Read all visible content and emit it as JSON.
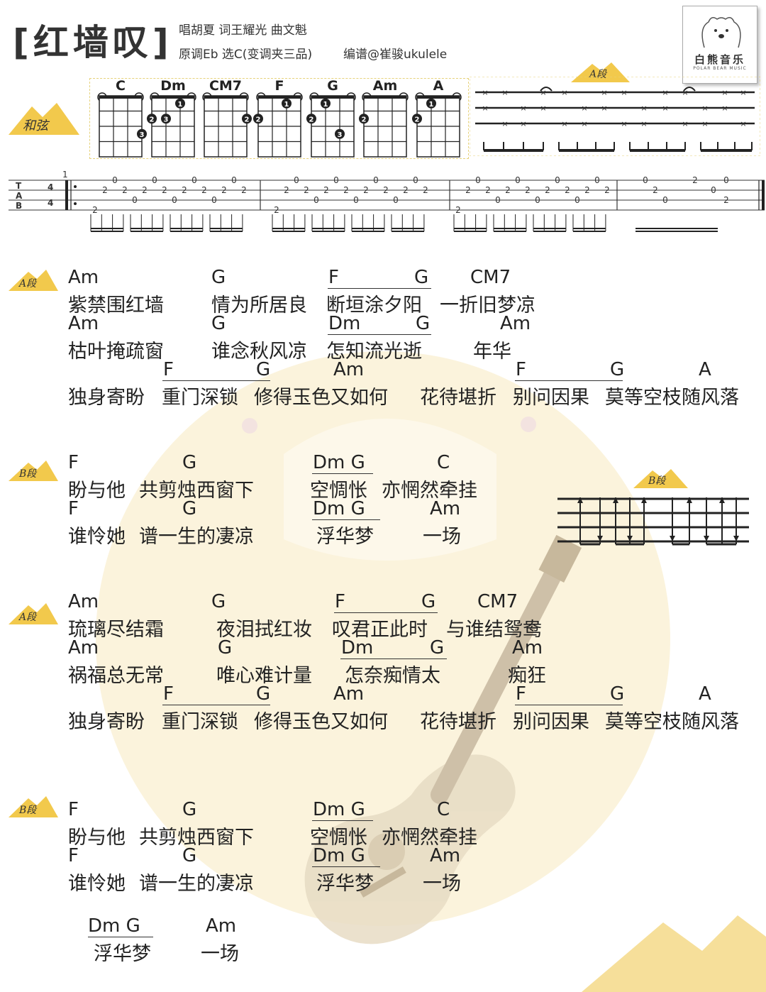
{
  "header": {
    "title": "[红墙叹]",
    "credits": "唱胡夏  词王耀光  曲文魁",
    "key_info": "原调Eb 选C(变调夹三品)",
    "arranger": "编谱@崔骏ukulele"
  },
  "logo": {
    "name": "白熊音乐",
    "sub": "POLAR BEAR MUSIC"
  },
  "labels": {
    "chords_section": "和弦",
    "section_a": "A段",
    "section_b": "B段",
    "tab_t": "T",
    "tab_a": "A",
    "tab_b": "B",
    "time_top": "4",
    "time_bottom": "4",
    "measure_number": "1"
  },
  "chord_names": [
    "C",
    "Dm",
    "CM7",
    "F",
    "G",
    "Am",
    "A"
  ],
  "verse_a1": {
    "line1_chords": [
      "Am",
      "G",
      "F",
      "G",
      "CM7"
    ],
    "line1_lyrics": [
      "紫禁围红墙",
      "情为所居良",
      "断垣涂夕阳",
      "一折旧梦凉"
    ],
    "line2_chords": [
      "Am",
      "G",
      "Dm",
      "G",
      "Am"
    ],
    "line2_lyrics": [
      "枯叶掩疏窗",
      "谁念秋风凉",
      "怎知流光逝",
      "年华"
    ],
    "line3_chords": [
      "F",
      "G",
      "Am",
      "F",
      "G",
      "A"
    ],
    "line3_lyrics": [
      "独身寄盼",
      "重门深锁",
      "修得玉色又如何",
      "花待堪折",
      "别问因果",
      "莫等空枝随风落"
    ]
  },
  "verse_b1": {
    "line1_chords": [
      "F",
      "G",
      "Dm G",
      "C"
    ],
    "line1_lyrics": [
      "盼与他",
      "共剪烛西窗下",
      "空惆怅",
      "亦惘然牵挂"
    ],
    "line2_chords": [
      "F",
      "G",
      "Dm  G",
      "Am"
    ],
    "line2_lyrics": [
      "谁怜她",
      "谱一生的凄凉",
      "浮华梦",
      "一场"
    ]
  },
  "verse_a2": {
    "line1_chords": [
      "Am",
      "G",
      "F",
      "G",
      "CM7"
    ],
    "line1_lyrics": [
      "琉璃尽结霜",
      "夜泪拭红妆",
      "叹君正此时",
      "与谁结鸳鸯"
    ],
    "line2_chords": [
      "Am",
      "G",
      "Dm",
      "G",
      "Am"
    ],
    "line2_lyrics": [
      "祸福总无常",
      "唯心难计量",
      "怎奈痴情太",
      "痴狂"
    ],
    "line3_chords": [
      "F",
      "G",
      "Am",
      "F",
      "G",
      "A"
    ],
    "line3_lyrics": [
      "独身寄盼",
      "重门深锁",
      "修得玉色又如何",
      "花待堪折",
      "别问因果",
      "莫等空枝随风落"
    ]
  },
  "verse_b2": {
    "line1_chords": [
      "F",
      "G",
      "Dm G",
      "C"
    ],
    "line1_lyrics": [
      "盼与他",
      "共剪烛西窗下",
      "空惆怅",
      "亦惘然牵挂"
    ],
    "line2_chords": [
      "F",
      "G",
      "Dm  G",
      "Am"
    ],
    "line2_lyrics": [
      "谁怜她",
      "谱一生的凄凉",
      "浮华梦",
      "一场"
    ]
  },
  "outro": {
    "chords": [
      "Dm  G",
      "Am"
    ],
    "lyrics": [
      "浮华梦",
      "一场"
    ]
  },
  "colors": {
    "accent_yellow": "#f2c94c",
    "moon": "#fbf3dc"
  }
}
